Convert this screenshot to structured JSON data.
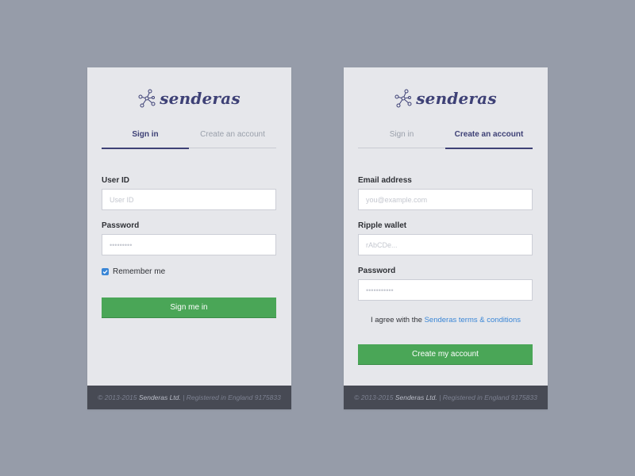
{
  "brand": {
    "name": "senderas",
    "icon": "network-nodes-icon"
  },
  "colors": {
    "background": "#969ca9",
    "card": "#e6e7eb",
    "brand": "#3e4176",
    "accent_green": "#4aa657",
    "link_blue": "#3a86d6",
    "footer": "#474a54"
  },
  "signin": {
    "tabs": {
      "signin": "Sign in",
      "register": "Create an account",
      "active": "signin"
    },
    "user_id_label": "User ID",
    "user_id_placeholder": "User ID",
    "password_label": "Password",
    "password_placeholder": "•••••••••",
    "remember_label": "Remember me",
    "remember_checked": true,
    "submit_label": "Sign me in",
    "footer": {
      "copyright": "© 2013-2015",
      "company": "Senderas Ltd.",
      "registered": "| Registered in England 9175833"
    }
  },
  "register": {
    "tabs": {
      "signin": "Sign in",
      "register": "Create an account",
      "active": "register"
    },
    "email_label": "Email address",
    "email_placeholder": "you@example.com",
    "wallet_label": "Ripple wallet",
    "wallet_placeholder": "rAbCDe...",
    "password_label": "Password",
    "password_placeholder": "•••••••••••",
    "terms_prefix": "I agree with the",
    "terms_link": "Senderas terms & conditions",
    "submit_label": "Create my account",
    "footer": {
      "copyright": "© 2013-2015",
      "company": "Senderas Ltd.",
      "registered": "| Registered in England 9175833"
    }
  }
}
